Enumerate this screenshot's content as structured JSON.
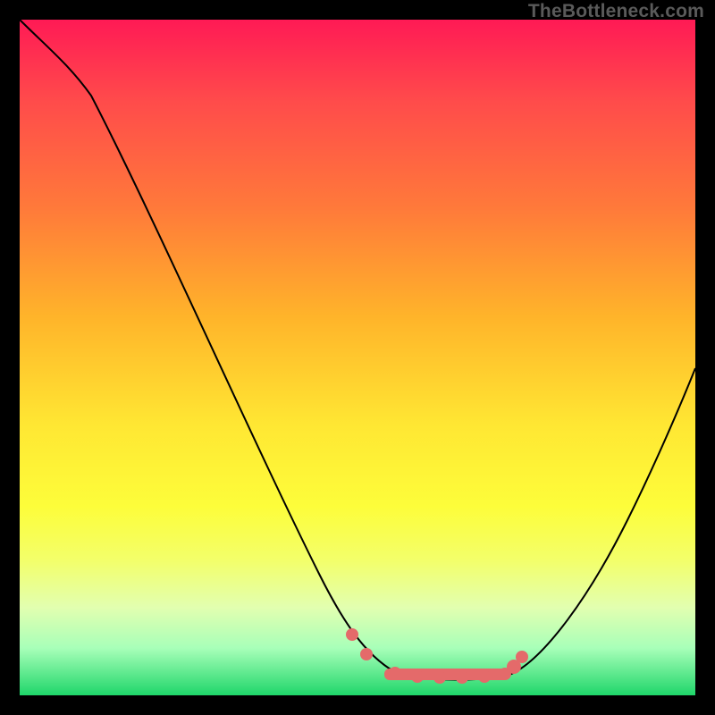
{
  "branding": "TheBottleneck.com",
  "chart_data": {
    "type": "line",
    "title": "",
    "xlabel": "",
    "ylabel": "",
    "xlim": [
      0,
      100
    ],
    "ylim": [
      0,
      100
    ],
    "x": [
      0,
      5,
      10,
      15,
      20,
      25,
      30,
      35,
      40,
      45,
      48,
      50,
      53,
      56,
      59,
      62,
      65,
      68,
      72,
      76,
      80,
      85,
      90,
      95,
      100
    ],
    "values": [
      100,
      97,
      92,
      85,
      76,
      67,
      57,
      47,
      37,
      27,
      20,
      14,
      10,
      6,
      3,
      1,
      0,
      0,
      0,
      1,
      4,
      11,
      22,
      36,
      51
    ],
    "note": "y is percentage height of black curve (0 = bottom, 100 = top). Red dots mark the valley floor.",
    "highlight_dots_x": [
      49,
      51,
      55,
      58,
      61,
      64,
      67,
      70,
      72.5,
      73.5
    ],
    "gradient_stops": [
      {
        "pct": 0,
        "color": "#ff1a55"
      },
      {
        "pct": 60,
        "color": "#ffe733"
      },
      {
        "pct": 100,
        "color": "#1fd66a"
      }
    ]
  }
}
